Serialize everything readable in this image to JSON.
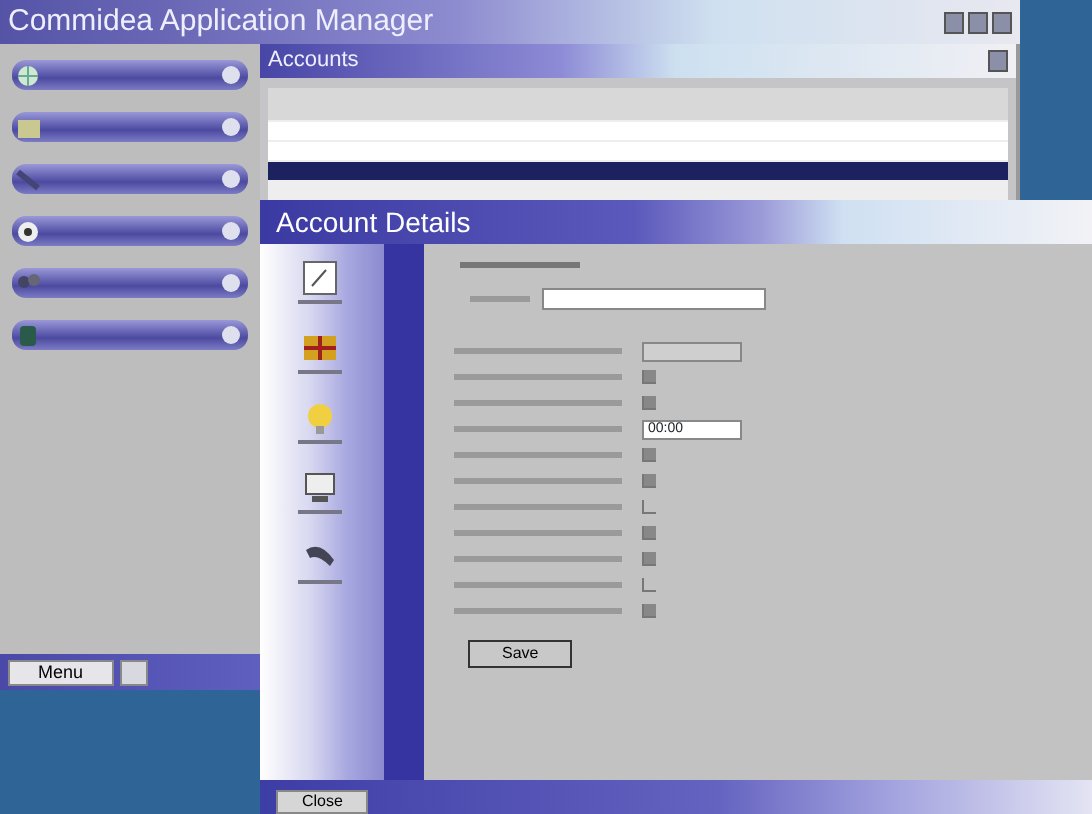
{
  "window": {
    "title": "Commidea Application Manager"
  },
  "nav_items": [
    {
      "kind": "globe"
    },
    {
      "kind": "folder"
    },
    {
      "kind": "pen"
    },
    {
      "kind": "disc"
    },
    {
      "kind": "people"
    },
    {
      "kind": "bin"
    }
  ],
  "menu_bar": {
    "button": "Menu"
  },
  "accounts": {
    "title": "Accounts",
    "rows": [
      {
        "selected": false
      },
      {
        "selected": false
      },
      {
        "selected": true
      }
    ]
  },
  "account_details": {
    "title": "Account Details",
    "side_icons": [
      {
        "kind": "note"
      },
      {
        "kind": "grid"
      },
      {
        "kind": "bulb"
      },
      {
        "kind": "monitor"
      },
      {
        "kind": "phone"
      }
    ],
    "fields": [
      {
        "kind": "text",
        "disabled": true
      },
      {
        "kind": "check",
        "checked": true
      },
      {
        "kind": "check",
        "checked": true
      },
      {
        "kind": "text",
        "disabled": false,
        "value": "00:00"
      },
      {
        "kind": "check",
        "checked": true
      },
      {
        "kind": "check",
        "checked": true
      },
      {
        "kind": "check",
        "checked": false
      },
      {
        "kind": "check",
        "checked": true
      },
      {
        "kind": "check",
        "checked": true
      },
      {
        "kind": "check",
        "checked": false
      },
      {
        "kind": "check",
        "checked": true
      }
    ],
    "save_button": "Save",
    "close_button": "Close"
  }
}
